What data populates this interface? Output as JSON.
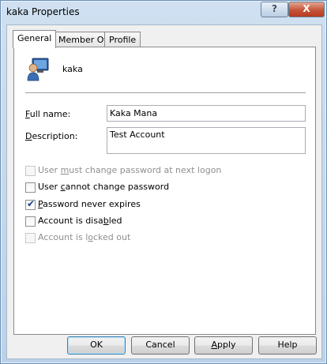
{
  "window": {
    "title": "kaka Properties",
    "help_glyph": "?",
    "close_glyph": "X"
  },
  "tabs": [
    {
      "label": "General",
      "active": true
    },
    {
      "label": "Member Of",
      "active": false
    },
    {
      "label": "Profile",
      "active": false
    }
  ],
  "user": {
    "name": "kaka",
    "icon": "user-icon"
  },
  "fields": {
    "full_name": {
      "label_prefix": "",
      "label_accel": "F",
      "label_rest": "ull name:",
      "value": "Kaka Mana"
    },
    "description": {
      "label_prefix": "",
      "label_accel": "D",
      "label_rest": "escription:",
      "value": "Test Account"
    }
  },
  "options": [
    {
      "pre": "User ",
      "accel": "m",
      "post": "ust change password at next logon",
      "checked": false,
      "enabled": false
    },
    {
      "pre": "User ",
      "accel": "c",
      "post": "annot change password",
      "checked": false,
      "enabled": true
    },
    {
      "pre": "",
      "accel": "P",
      "post": "assword never expires",
      "checked": true,
      "enabled": true
    },
    {
      "pre": "Account is disa",
      "accel": "b",
      "post": "led",
      "checked": false,
      "enabled": true
    },
    {
      "pre": "Account is l",
      "accel": "o",
      "post": "cked out",
      "checked": false,
      "enabled": false
    }
  ],
  "buttons": {
    "ok": {
      "pre": "",
      "accel": "",
      "post": "OK"
    },
    "cancel": {
      "pre": "",
      "accel": "",
      "post": "Cancel"
    },
    "apply": {
      "pre": "",
      "accel": "A",
      "post": "pply"
    },
    "help": {
      "pre": "",
      "accel": "",
      "post": "Help"
    }
  },
  "colors": {
    "check": "#1c3f8a",
    "disabled_text": "#8f8f8f",
    "close_button": "#c4543a"
  }
}
